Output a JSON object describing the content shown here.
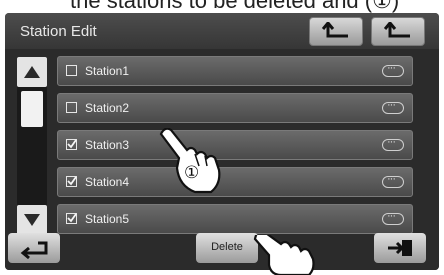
{
  "title": "Station Edit",
  "stations": [
    {
      "label": "Station1",
      "checked": false
    },
    {
      "label": "Station2",
      "checked": false
    },
    {
      "label": "Station3",
      "checked": true
    },
    {
      "label": "Station4",
      "checked": true
    },
    {
      "label": "Station5",
      "checked": true
    }
  ],
  "bottom": {
    "delete_label": "Delete"
  },
  "annotation": {
    "step_marker": "①"
  }
}
